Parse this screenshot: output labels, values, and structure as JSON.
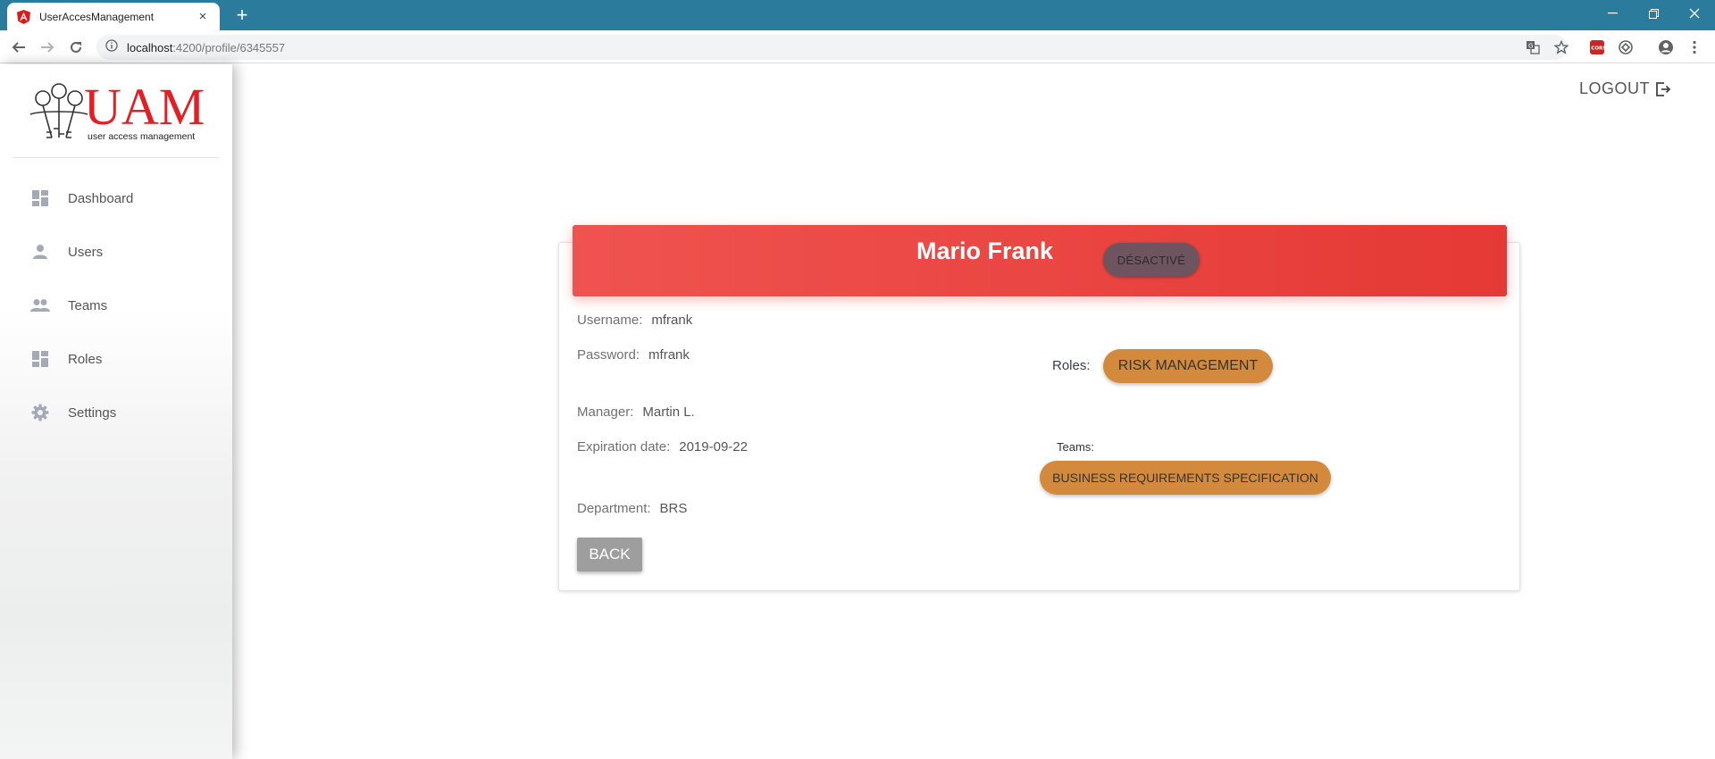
{
  "browser": {
    "tab_title": "UserAccesManagement",
    "url_host": "localhost",
    "url_path": ":4200/profile/6345557",
    "new_tab": "+",
    "close_tab": "×"
  },
  "sidebar": {
    "logo_text": "UAM",
    "logo_subtitle": "user access management",
    "items": [
      {
        "label": "Dashboard",
        "icon": "dashboard-icon"
      },
      {
        "label": "Users",
        "icon": "person-icon"
      },
      {
        "label": "Teams",
        "icon": "people-icon"
      },
      {
        "label": "Roles",
        "icon": "dashboard-icon"
      },
      {
        "label": "Settings",
        "icon": "gear-icon"
      }
    ]
  },
  "header": {
    "logout_label": "LOGOUT"
  },
  "profile": {
    "name": "Mario Frank",
    "status": "DÉSACTIVÉ",
    "username_label": "Username:",
    "username": "mfrank",
    "password_label": "Password:",
    "password": "mfrank",
    "manager_label": "Manager:",
    "manager": "Martin L.",
    "expiration_label": "Expiration date:",
    "expiration": "2019-09-22",
    "department_label": "Department:",
    "department": "BRS",
    "roles_label": "Roles:",
    "roles": [
      "RISK MANAGEMENT"
    ],
    "teams_label": "Teams:",
    "teams": [
      "BUSINESS REQUIREMENTS SPECIFICATION"
    ],
    "back_label": "BACK"
  },
  "colors": {
    "tabbar": "#2b7b9c",
    "header_red": "#e53935",
    "chip_orange": "#d48a3d",
    "status_badge": "#6e545e",
    "back_button": "#9e9e9e"
  }
}
